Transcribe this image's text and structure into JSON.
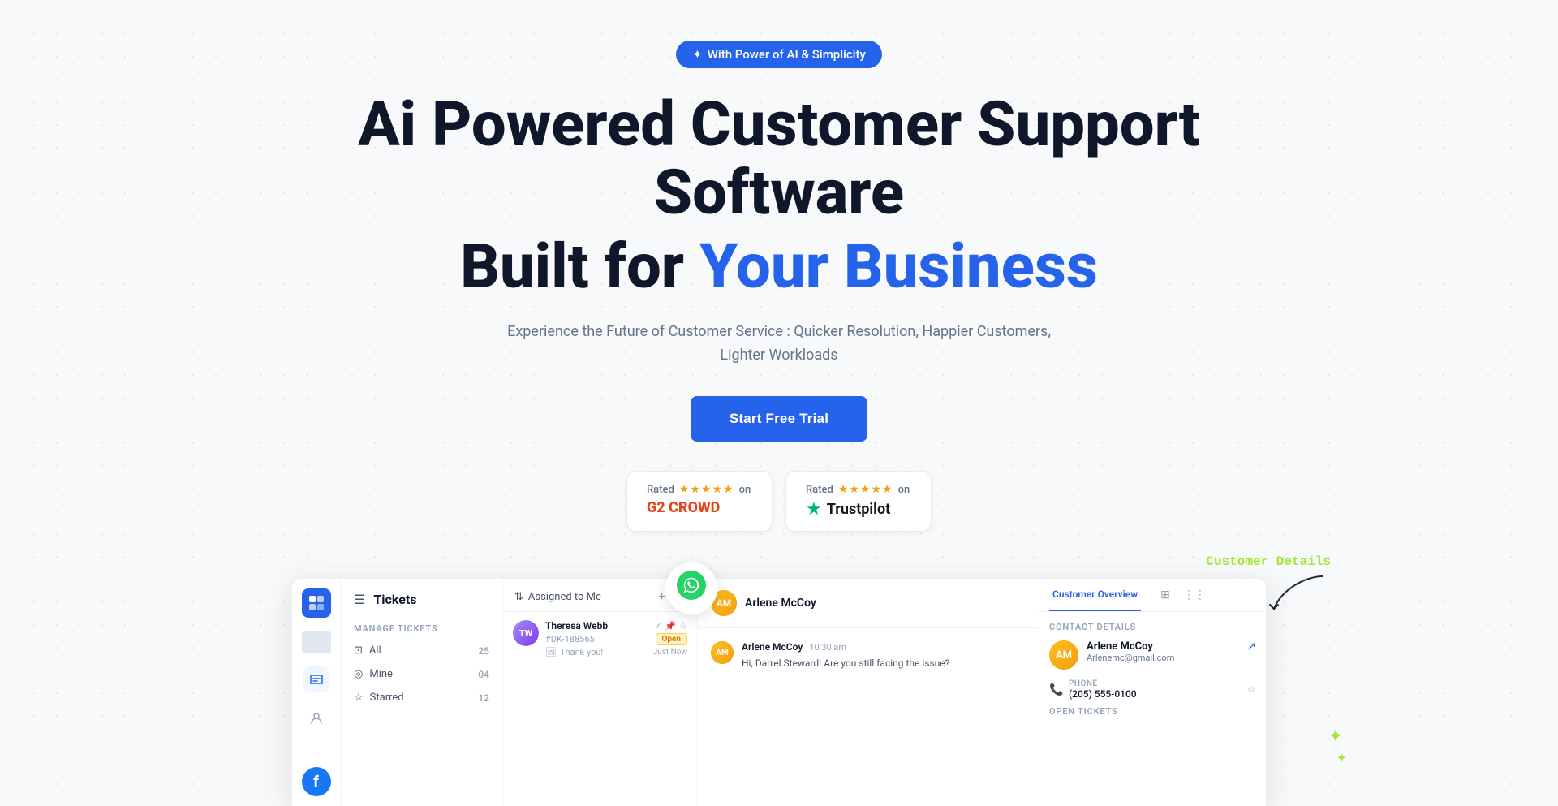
{
  "badge": {
    "icon": "✦",
    "text": "With Power of AI & Simplicity"
  },
  "hero": {
    "title_line1": "Ai Powered Customer Support Software",
    "title_line2_prefix": "Built for ",
    "title_line2_highlight": "Your Business",
    "subtitle": "Experience the Future of Customer Service : Quicker Resolution, Happier Customers, Lighter Workloads",
    "cta_label": "Start Free Trial"
  },
  "ratings": [
    {
      "prefix": "Rated",
      "stars": "★★★★★",
      "on": "on",
      "platform_icon": "G2",
      "platform_name": "CROWD"
    },
    {
      "prefix": "Rated",
      "stars": "★★★★★",
      "on": "on",
      "platform_icon": "✦",
      "platform_name": "Trustpilot"
    }
  ],
  "ui_preview": {
    "customer_details_annotation": "Customer Details",
    "whatsapp_icon": "💬",
    "sidebar": {
      "logo": "◆",
      "facebook_initial": "f"
    },
    "left_panel": {
      "title": "Tickets",
      "section_label": "Manage Tickets",
      "nav_items": [
        {
          "icon": "⊡",
          "label": "All",
          "count": "25"
        },
        {
          "icon": "◎",
          "label": "Mine",
          "count": "04"
        },
        {
          "icon": "☆",
          "label": "Starred",
          "count": "12"
        }
      ]
    },
    "ticket_list": {
      "header_title": "Assigned to Me",
      "tickets": [
        {
          "name": "Theresa Webb",
          "id": "#DK-188565",
          "status": "Open",
          "preview": "Thank you!",
          "time": "Just Now",
          "avatar_initials": "TW"
        }
      ]
    },
    "chat": {
      "header_name": "Arlene McCoy",
      "messages": [
        {
          "sender": "Arlene McCoy",
          "time": "10:30 am",
          "text": "Hi, Darrel Steward! Are you still facing the issue?",
          "avatar_initials": "AM"
        }
      ]
    },
    "customer_panel": {
      "tab_label": "Customer Overview",
      "contact_details_label": "Contact Details",
      "contact": {
        "name": "Arlene McCoy",
        "email": "Arlenemc@gmail.com",
        "phone_label": "PHONE",
        "phone": "(205) 555-0100"
      },
      "open_tickets_label": "OPEN TICKETS"
    }
  }
}
